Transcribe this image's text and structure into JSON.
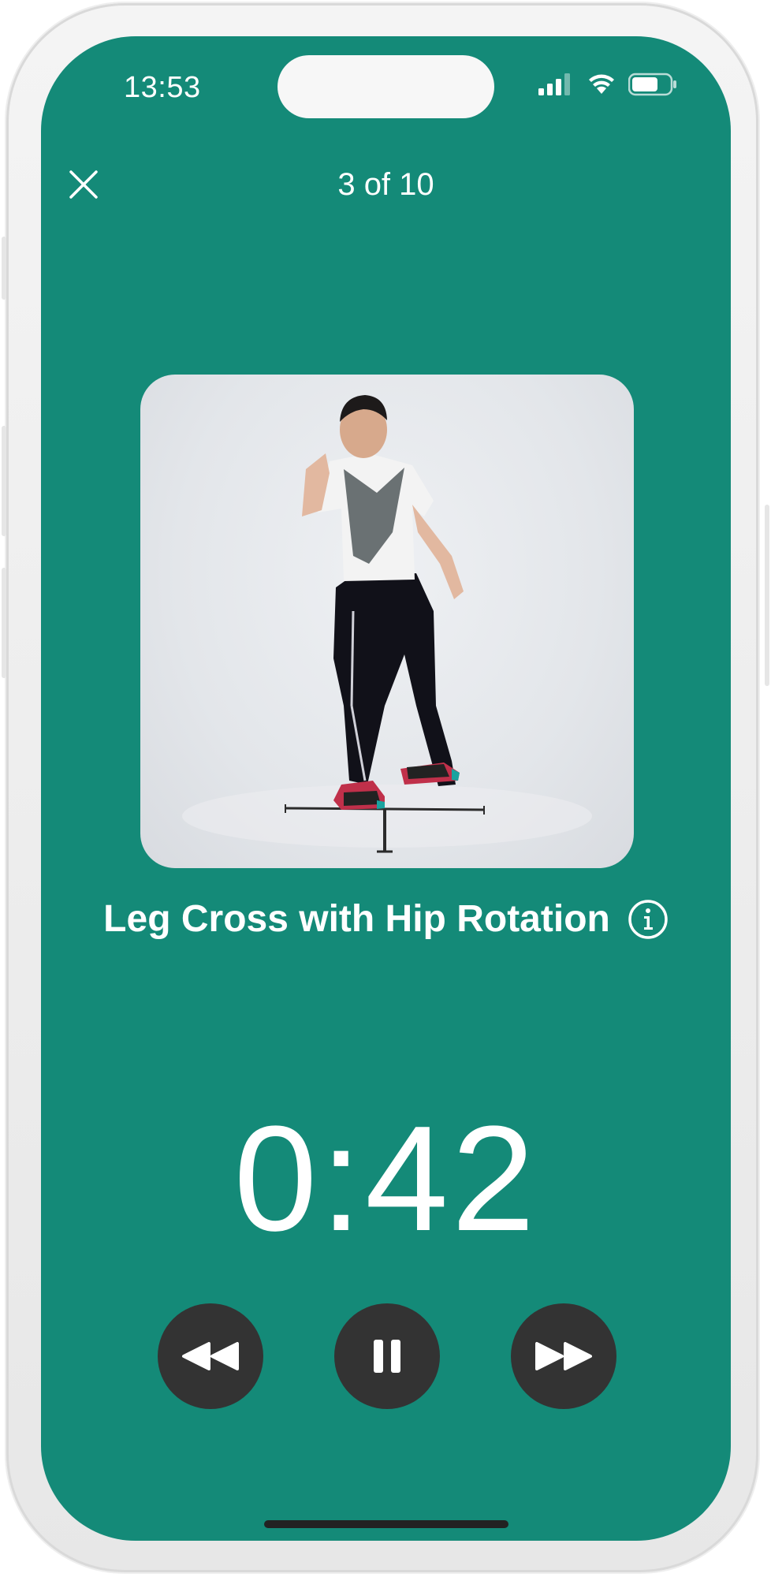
{
  "status_bar": {
    "time": "13:53"
  },
  "header": {
    "progress": "3 of 10",
    "current_index": 3,
    "total": 10
  },
  "exercise": {
    "title": "Leg Cross with Hip Rotation"
  },
  "timer": {
    "remaining": "0:42"
  },
  "controls": {
    "rewind_icon": "rewind-icon",
    "pause_icon": "pause-icon",
    "forward_icon": "fast-forward-icon"
  },
  "colors": {
    "background": "#148a78",
    "control_button": "#333333",
    "text": "#ffffff"
  }
}
